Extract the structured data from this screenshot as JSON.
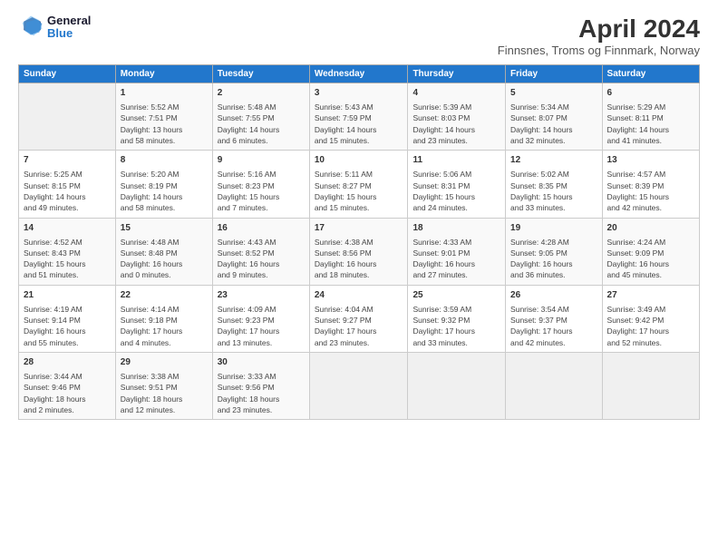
{
  "header": {
    "logo_line1": "General",
    "logo_line2": "Blue",
    "title": "April 2024",
    "subtitle": "Finnsnes, Troms og Finnmark, Norway"
  },
  "columns": [
    "Sunday",
    "Monday",
    "Tuesday",
    "Wednesday",
    "Thursday",
    "Friday",
    "Saturday"
  ],
  "weeks": [
    [
      {
        "num": "",
        "info": ""
      },
      {
        "num": "1",
        "info": "Sunrise: 5:52 AM\nSunset: 7:51 PM\nDaylight: 13 hours\nand 58 minutes."
      },
      {
        "num": "2",
        "info": "Sunrise: 5:48 AM\nSunset: 7:55 PM\nDaylight: 14 hours\nand 6 minutes."
      },
      {
        "num": "3",
        "info": "Sunrise: 5:43 AM\nSunset: 7:59 PM\nDaylight: 14 hours\nand 15 minutes."
      },
      {
        "num": "4",
        "info": "Sunrise: 5:39 AM\nSunset: 8:03 PM\nDaylight: 14 hours\nand 23 minutes."
      },
      {
        "num": "5",
        "info": "Sunrise: 5:34 AM\nSunset: 8:07 PM\nDaylight: 14 hours\nand 32 minutes."
      },
      {
        "num": "6",
        "info": "Sunrise: 5:29 AM\nSunset: 8:11 PM\nDaylight: 14 hours\nand 41 minutes."
      }
    ],
    [
      {
        "num": "7",
        "info": "Sunrise: 5:25 AM\nSunset: 8:15 PM\nDaylight: 14 hours\nand 49 minutes."
      },
      {
        "num": "8",
        "info": "Sunrise: 5:20 AM\nSunset: 8:19 PM\nDaylight: 14 hours\nand 58 minutes."
      },
      {
        "num": "9",
        "info": "Sunrise: 5:16 AM\nSunset: 8:23 PM\nDaylight: 15 hours\nand 7 minutes."
      },
      {
        "num": "10",
        "info": "Sunrise: 5:11 AM\nSunset: 8:27 PM\nDaylight: 15 hours\nand 15 minutes."
      },
      {
        "num": "11",
        "info": "Sunrise: 5:06 AM\nSunset: 8:31 PM\nDaylight: 15 hours\nand 24 minutes."
      },
      {
        "num": "12",
        "info": "Sunrise: 5:02 AM\nSunset: 8:35 PM\nDaylight: 15 hours\nand 33 minutes."
      },
      {
        "num": "13",
        "info": "Sunrise: 4:57 AM\nSunset: 8:39 PM\nDaylight: 15 hours\nand 42 minutes."
      }
    ],
    [
      {
        "num": "14",
        "info": "Sunrise: 4:52 AM\nSunset: 8:43 PM\nDaylight: 15 hours\nand 51 minutes."
      },
      {
        "num": "15",
        "info": "Sunrise: 4:48 AM\nSunset: 8:48 PM\nDaylight: 16 hours\nand 0 minutes."
      },
      {
        "num": "16",
        "info": "Sunrise: 4:43 AM\nSunset: 8:52 PM\nDaylight: 16 hours\nand 9 minutes."
      },
      {
        "num": "17",
        "info": "Sunrise: 4:38 AM\nSunset: 8:56 PM\nDaylight: 16 hours\nand 18 minutes."
      },
      {
        "num": "18",
        "info": "Sunrise: 4:33 AM\nSunset: 9:01 PM\nDaylight: 16 hours\nand 27 minutes."
      },
      {
        "num": "19",
        "info": "Sunrise: 4:28 AM\nSunset: 9:05 PM\nDaylight: 16 hours\nand 36 minutes."
      },
      {
        "num": "20",
        "info": "Sunrise: 4:24 AM\nSunset: 9:09 PM\nDaylight: 16 hours\nand 45 minutes."
      }
    ],
    [
      {
        "num": "21",
        "info": "Sunrise: 4:19 AM\nSunset: 9:14 PM\nDaylight: 16 hours\nand 55 minutes."
      },
      {
        "num": "22",
        "info": "Sunrise: 4:14 AM\nSunset: 9:18 PM\nDaylight: 17 hours\nand 4 minutes."
      },
      {
        "num": "23",
        "info": "Sunrise: 4:09 AM\nSunset: 9:23 PM\nDaylight: 17 hours\nand 13 minutes."
      },
      {
        "num": "24",
        "info": "Sunrise: 4:04 AM\nSunset: 9:27 PM\nDaylight: 17 hours\nand 23 minutes."
      },
      {
        "num": "25",
        "info": "Sunrise: 3:59 AM\nSunset: 9:32 PM\nDaylight: 17 hours\nand 33 minutes."
      },
      {
        "num": "26",
        "info": "Sunrise: 3:54 AM\nSunset: 9:37 PM\nDaylight: 17 hours\nand 42 minutes."
      },
      {
        "num": "27",
        "info": "Sunrise: 3:49 AM\nSunset: 9:42 PM\nDaylight: 17 hours\nand 52 minutes."
      }
    ],
    [
      {
        "num": "28",
        "info": "Sunrise: 3:44 AM\nSunset: 9:46 PM\nDaylight: 18 hours\nand 2 minutes."
      },
      {
        "num": "29",
        "info": "Sunrise: 3:38 AM\nSunset: 9:51 PM\nDaylight: 18 hours\nand 12 minutes."
      },
      {
        "num": "30",
        "info": "Sunrise: 3:33 AM\nSunset: 9:56 PM\nDaylight: 18 hours\nand 23 minutes."
      },
      {
        "num": "",
        "info": ""
      },
      {
        "num": "",
        "info": ""
      },
      {
        "num": "",
        "info": ""
      },
      {
        "num": "",
        "info": ""
      }
    ]
  ]
}
